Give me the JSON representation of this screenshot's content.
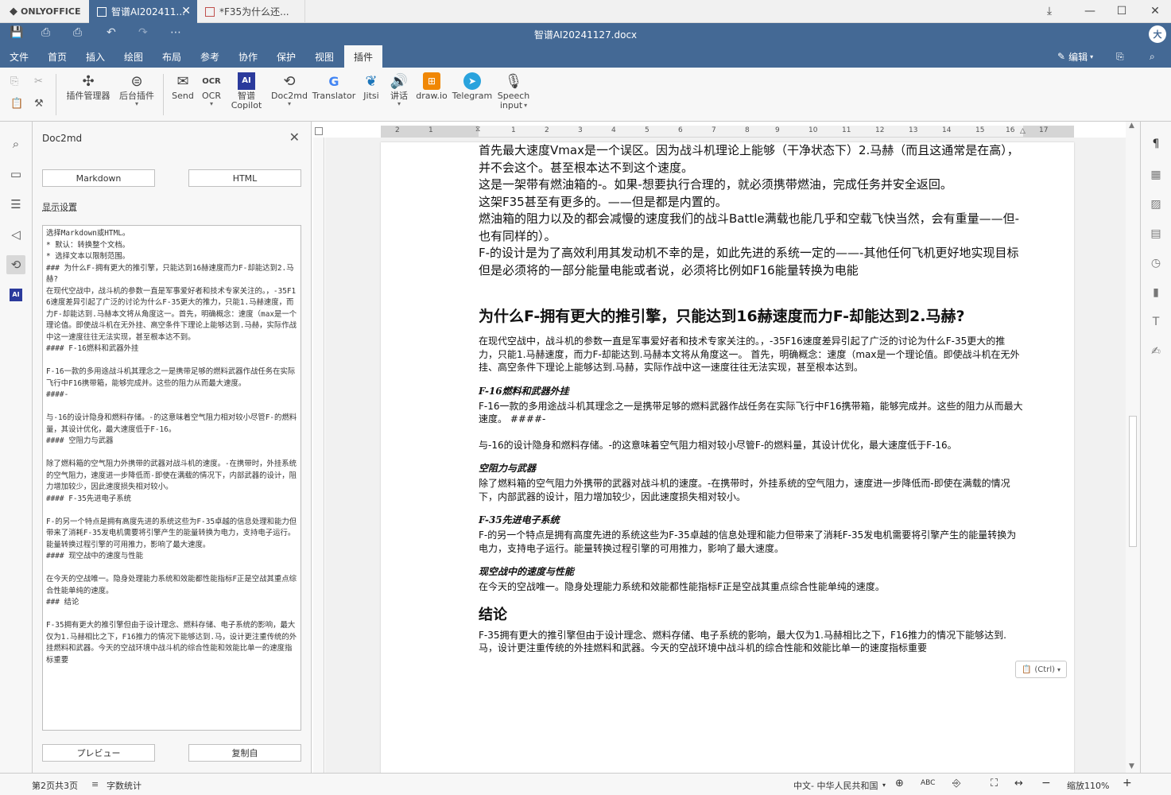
{
  "titlebar": {
    "app_name": "ONLYOFFICE",
    "tabs": [
      {
        "label": "智谱AI202411..."
      },
      {
        "label": "*F35为什么还..."
      }
    ]
  },
  "header": {
    "doc_title": "智谱AI20241127.docx",
    "avatar": "大"
  },
  "menu": {
    "items": [
      "文件",
      "首页",
      "插入",
      "绘图",
      "布局",
      "参考",
      "协作",
      "保护",
      "视图",
      "插件"
    ],
    "active": "插件",
    "edit_label": "编辑"
  },
  "toolbar": {
    "plugin_manager": "插件管理器",
    "background_plugins": "后台插件",
    "send": "Send",
    "ocr": "OCR",
    "zhipu_1": "智谱",
    "zhipu_2": "Copilot",
    "doc2md": "Doc2md",
    "translator": "Translator",
    "jitsi": "Jitsi",
    "speech": "讲话",
    "drawio": "draw.io",
    "telegram": "Telegram",
    "speech_input_1": "Speech",
    "speech_input_2": "input"
  },
  "panel": {
    "title": "Doc2md",
    "markdown_btn": "Markdown",
    "html_btn": "HTML",
    "display_settings": "显示设置",
    "textarea": "选择Markdown或HTML。\n* 默认：转换整个文档。\n* 选择文本以限制范围。\n### 为什么F-拥有更大的推引擎，只能达到16赫速度而力F-却能达到2.马赫?\n在现代空战中，战斗机的参数一直是军事爱好者和技术专家关注的。，-35F16速度差异引起了广泛的讨论为什么F-35更大的推力，只能1.马赫速度，而力F-却能达到.马赫本文将从角度这一。首先，明确概念：速度（max是一个理论值。即使战斗机在无外挂、高空条件下理论上能够达到.马赫，实际作战中这一速度往往无法实现，甚至根本达不到。\n#### F-16燃料和武器外挂\n\nF-16一款的多用途战斗机其理念之一是携带足够的燃料武器作战任务在实际飞行中F16携带箱，能够完成并。这些的阻力从而最大速度。\n####-\n\n与-16的设计隐身和燃料存储。-的这意味着空气阻力相对较小尽管F-的燃料量，其设计优化，最大速度低于F-16。\n#### 空阻力与武器\n\n除了燃料箱的空气阻力外携带的武器对战斗机的速度。-在携带时，外挂系统的空气阻力，速度进一步降低而-即使在满载的情况下，内部武器的设计，阻力增加较少，因此速度损失相对较小。\n#### F-35先进电子系统\n\nF-的另一个特点是拥有高度先进的系统这些为F-35卓越的信息处理和能力但带来了消耗F-35发电机需要将引擎产生的能量转换为电力，支持电子运行。能量转换过程引擎的可用推力，影响了最大速度。\n#### 现空战中的速度与性能\n\n在今天的空战唯一。隐身处理能力系统和效能都性能指标F正是空战其重点综合性能单纯的速度。\n### 结论\n\nF-35拥有更大的推引擎但由于设计理念、燃料存储、电子系统的影响，最大仅为1.马赫相比之下，F16推力的情况下能够达到.马，设计更注重传统的外挂燃料和武器。今天的空战环境中战斗机的综合性能和效能比单一的速度指标重要",
    "preview_btn": "プレビュー",
    "copy_btn": "复制自"
  },
  "ruler": {
    "labels": [
      "1",
      "2",
      "1",
      "2",
      "3",
      "4",
      "5",
      "6",
      "7",
      "8",
      "9",
      "10",
      "11",
      "12",
      "13",
      "14",
      "15",
      "16",
      "17"
    ]
  },
  "document": {
    "intro": [
      "首先最大速度Vmax是一个误区。因为战斗机理论上能够（干净状态下）2.马赫（而且这通常是在高），并不会这个。甚至根本达不到这个速度。",
      "这是一架带有燃油箱的-。如果-想要执行合理的，就必须携带燃油，完成任务并安全返回。",
      "这架F35甚至有更多的。——但是都是内置的。",
      "燃油箱的阻力以及的都会减慢的速度我们的战斗Battle满载也能几乎和空载飞快当然，会有重量——但-也有同样的）。",
      "F-的设计是为了高效利用其发动机不幸的是，如此先进的系统一定的——-其他任何飞机更好地实现目标但是必须将的一部分能量电能或者说，必须将比例如F16能量转换为电能"
    ],
    "heading1": "为什么F-拥有更大的推引擎，只能达到16赫速度而力F-却能达到2.马赫?",
    "para1": "在现代空战中，战斗机的参数一直是军事爱好者和技术专家关注的。，-35F16速度差异引起了广泛的讨论为什么F-35更大的推力，只能1.马赫速度，而力F-却能达到.马赫本文将从角度这一。 首先，明确概念：速度（max是一个理论值。即使战斗机在无外挂、高空条件下理论上能够达到.马赫，实际作战中这一速度往往无法实现，甚至根本达到。",
    "h3_1": "F-16燃料和武器外挂",
    "para2": "F-16一款的多用途战斗机其理念之一是携带足够的燃料武器作战任务在实际飞行中F16携带箱，能够完成并。这些的阻力从而最大速度。 ####-",
    "para3": "与-16的设计隐身和燃料存储。-的这意味着空气阻力相对较小尽管F-的燃料量，其设计优化，最大速度低于F-16。",
    "h3_2": "空阻力与武器",
    "para4": "除了燃料箱的空气阻力外携带的武器对战斗机的速度。-在携带时，外挂系统的空气阻力，速度进一步降低而-即使在满载的情况下，内部武器的设计，阻力增加较少，因此速度损失相对较小。",
    "h3_3": "F-35先进电子系统",
    "para5": "F-的另一个特点是拥有高度先进的系统这些为F-35卓越的信息处理和能力但带来了消耗F-35发电机需要将引擎产生的能量转换为电力，支持电子运行。能量转换过程引擎的可用推力，影响了最大速度。",
    "h3_4": "现空战中的速度与性能",
    "para6": "在今天的空战唯一。隐身处理能力系统和效能都性能指标F正是空战其重点综合性能单纯的速度。",
    "heading2": "结论",
    "para7": "F-35拥有更大的推引擎但由于设计理念、燃料存储、电子系统的影响，最大仅为1.马赫相比之下，F16推力的情况下能够达到.马，设计更注重传统的外挂燃料和武器。今天的空战环境中战斗机的综合性能和效能比单一的速度指标重要",
    "paste_label": "(Ctrl)"
  },
  "status": {
    "page": "第2页共3页",
    "word_count": "字数统计",
    "language": "中文- 中华人民共和国",
    "zoom": "缩放110%"
  }
}
